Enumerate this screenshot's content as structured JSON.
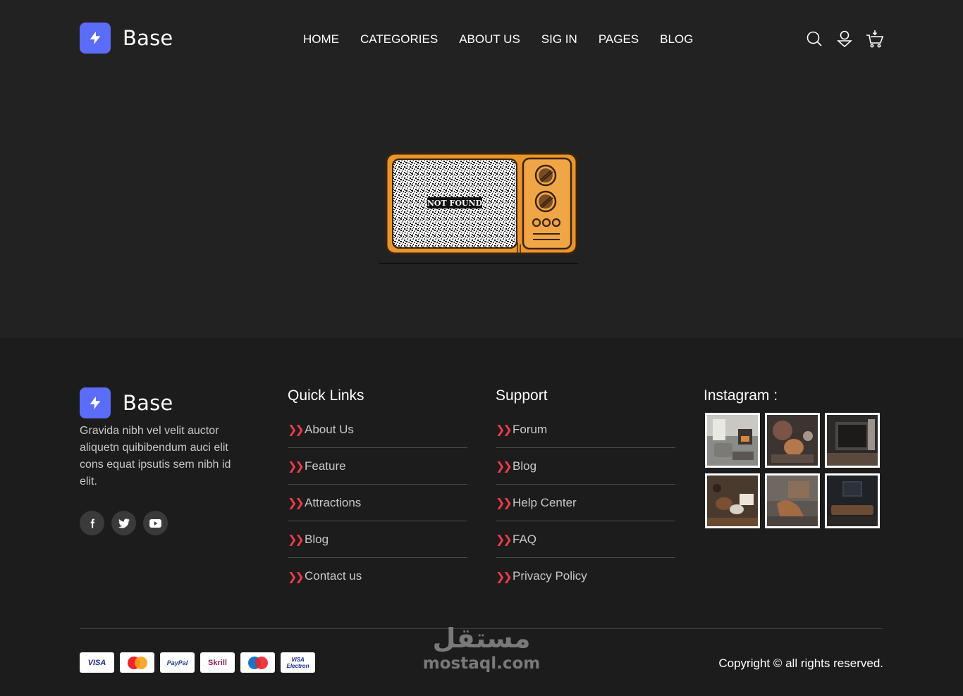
{
  "header": {
    "logo_text": "Base",
    "nav": [
      "HOME",
      "CATEGORIES",
      "ABOUT US",
      "SIG IN",
      "PAGES",
      "BLOG"
    ]
  },
  "tv": {
    "screen_label": "NOT FOUND"
  },
  "footer": {
    "logo_text": "Base",
    "about": "Gravida nibh vel velit auctor aliquetn quibibendum auci elit cons equat ipsutis sem nibh id elit.",
    "quick_links": {
      "title": "Quick Links",
      "items": [
        "About Us",
        "Feature",
        "Attractions",
        "Blog",
        "Contact us"
      ]
    },
    "support": {
      "title": "Support",
      "items": [
        "Forum",
        "Blog",
        "Help Center",
        "FAQ",
        "Privacy Policy"
      ]
    },
    "instagram": {
      "title": "Instagram :"
    },
    "payments": [
      "VISA",
      "MasterCard",
      "PayPal",
      "Skrill",
      "Maestro",
      "VISA Electron"
    ],
    "copyright": "Copyright © all rights reserved.",
    "watermark": {
      "arabic": "مستقل",
      "latin": "mostaql.com"
    }
  },
  "colors": {
    "accent": "#5b6cf9",
    "chevron": "#ef3b4a",
    "header_bg": "#222222",
    "footer_bg": "#1c1c1c",
    "tv_orange": "#e8952c"
  }
}
